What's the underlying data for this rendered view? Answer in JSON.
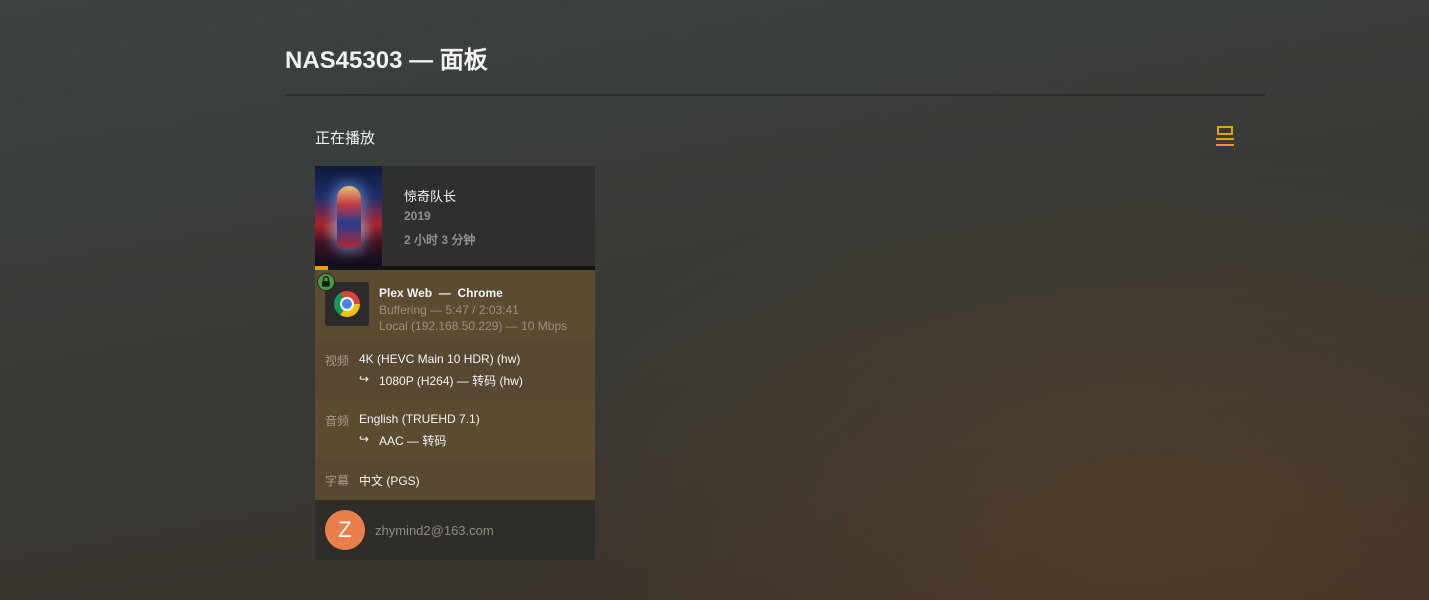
{
  "header": {
    "title": "NAS45303 — 面板"
  },
  "now_playing": {
    "heading": "正在播放",
    "view_toggle_icon": "list-view-icon",
    "accent_color": "#e5a00d"
  },
  "session": {
    "poster_icon": "movie-poster",
    "title": "惊奇队长",
    "year": "2019",
    "duration": "2 小时 3 分钟",
    "progress_fraction": 0.047,
    "secure_icon": "lock-icon",
    "player": {
      "icon": "chrome-icon",
      "name": "Plex Web  —  Chrome",
      "state": "Buffering — 5:47 / 2:03:41",
      "location": "Local (192.168.50.229) — 10 Mbps"
    },
    "video": {
      "label": "视频",
      "source": "4K (HEVC Main 10 HDR) (hw)",
      "arrow": "↪",
      "target": "1080P (H264) — 转码 (hw)"
    },
    "audio": {
      "label": "音频",
      "source": "English (TRUEHD 7.1)",
      "arrow": "↪",
      "target": "AAC — 转码"
    },
    "subtitle": {
      "label": "字幕",
      "value": "中文 (PGS)"
    },
    "user": {
      "avatar_letter": "Z",
      "avatar_color": "#ea7f4b",
      "name": "zhymind2@163.com"
    }
  }
}
